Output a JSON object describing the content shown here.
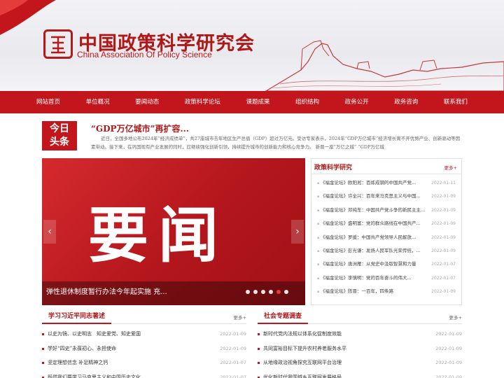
{
  "header": {
    "logo_cn": "中国政策科学研究会",
    "logo_en": "China Association Of  Policy Science"
  },
  "nav": {
    "items": [
      "网站首页",
      "单位概况",
      "要闻动态",
      "政策科学论坛",
      "课题成果",
      "组织结构",
      "政务公开",
      "政务咨询",
      "联系我们"
    ]
  },
  "headline": {
    "badge_line1": "今日",
    "badge_line2": "头条",
    "title": "“GDP万亿城市”再扩容...",
    "summary": "近日，全国多地公布2024年“经济成绩单”，共27座城市去年地区生产总值（GDP）超过万亿元。受访专家表示，2024年“GDP万亿城市”经济增长离不开优势产业、创新驱动等因素带动。接下来，在巩固现有产业发展的同时，应继续强化创新引领，持续提升城市的创新能力和核心竞争力。          新晋一座“万亿之城”          “GDP万亿城"
  },
  "slider": {
    "big_text": "要闻",
    "caption": "弹性退休制度暂行办法今年起实施 充...",
    "dots": 6,
    "active_dot": 5,
    "prev_label": "‹",
    "next_label": "›"
  },
  "policy_panel": {
    "title": "政策科学研究",
    "more": "更多+",
    "items": [
      {
        "title": "《福金论坛》欧阳淞：百炼成钢的中国共产党...",
        "date": "2022-01-11"
      },
      {
        "title": "《福金论坛》许全兴：百年来马克思主义与中国...",
        "date": "2022-01-09"
      },
      {
        "title": "《福金论坛》邓纯东：中国共产党斗争的新民主主...",
        "date": "2022-01-09"
      },
      {
        "title": "《福金论坛》盛明富：党的群众路线在中国共产...",
        "date": "2022-01-09"
      },
      {
        "title": "《福金论坛》罗援：中国共产党领导人民解放...",
        "date": "2022-01-09"
      },
      {
        "title": "《福金论坛》彭光谦：发扬人民军队光荣传统，...",
        "date": "2022-01-09"
      },
      {
        "title": "《福金论坛》唐洲雁：从党史中汲取智慧和力量",
        "date": "2022-01-07"
      },
      {
        "title": "《福金论坛》李慎明：党的百年奋斗的伟大...",
        "date": "2022-01-07"
      },
      {
        "title": "《福金论坛》陈晋：一百年，四条路",
        "date": "2022-01-09"
      }
    ]
  },
  "left_column": {
    "title": "学习习近平同志著述",
    "more": "更多+",
    "items": [
      {
        "title": "以史为镜、以史明志　知史爱党、知史爱国",
        "date": "2022-01-09"
      },
      {
        "title": "学好“四史”永葆初心、永担使命",
        "date": "2022-01-09"
      },
      {
        "title": "坚定理想信念 补足精神之钙",
        "date": "2022-01-07"
      },
      {
        "title": "既然我们要学习马克思主义和中国历史文化...",
        "date": "2022-01-07"
      }
    ]
  },
  "right_column": {
    "title": "社会专题调查",
    "more": "更多+",
    "items": [
      {
        "title": "新时代党内法规以体系化促制度效能",
        "date": "2022-01-09"
      },
      {
        "title": "共同富裕目标下提升农村养老服务水平",
        "date": "2022-01-09"
      },
      {
        "title": "从地缘政治视角探究互联网平台治理",
        "date": "2022-01-09"
      },
      {
        "title": "优化新时代我国城乡互联网发展格局",
        "date": "2022-01-09"
      }
    ]
  },
  "colors": {
    "brand_red": "#c2161c",
    "title_red": "#b01818"
  }
}
